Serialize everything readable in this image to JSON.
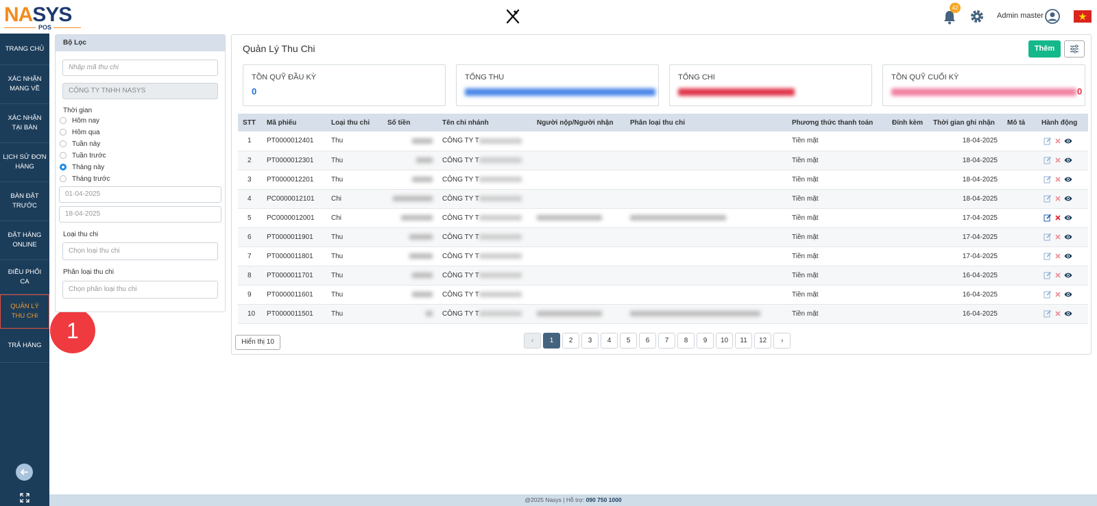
{
  "logo": {
    "na": "NA",
    "s": "SYS",
    "pos": "POS"
  },
  "header": {
    "notification_count": "42",
    "user_name": "Admin master"
  },
  "sidebar": {
    "items": [
      {
        "label": "TRANG CHỦ"
      },
      {
        "label": "XÁC NHẬN MANG VỀ"
      },
      {
        "label": "XÁC NHẬN TẠI BÀN"
      },
      {
        "label": "LỊCH SỬ ĐƠN HÀNG"
      },
      {
        "label": "BÀN ĐẶT TRƯỚC"
      },
      {
        "label": "ĐẶT HÀNG ONLINE"
      },
      {
        "label": "ĐIỀU PHỐI CA"
      },
      {
        "label": "QUẢN LÝ THU CHI"
      },
      {
        "label": "TRẢ HÀNG"
      }
    ]
  },
  "step_badge": "1",
  "filter": {
    "title": "Bộ Lọc",
    "code_placeholder": "Nhập mã thu chi",
    "company_value": "CÔNG TY TNHH NASYS",
    "time_label": "Thời gian",
    "time_options": [
      "Hôm nay",
      "Hôm qua",
      "Tuần này",
      "Tuần trước",
      "Tháng này",
      "Tháng trước"
    ],
    "selected_time": "Tháng này",
    "date_from": "01-04-2025",
    "date_to": "18-04-2025",
    "type_label": "Loại thu chi",
    "type_placeholder": "Chọn loại thu chi",
    "category_label": "Phân loại thu chi",
    "category_placeholder": "Chọn phân loại thu chi"
  },
  "main": {
    "title": "Quản Lý Thu Chi",
    "add_label": "Thêm",
    "cards": [
      {
        "label": "TỒN QUỸ ĐẦU KỲ",
        "value": "0",
        "color": "#1e6fd9"
      },
      {
        "label": "TỔNG THU",
        "value": "",
        "color": "#1e6fd9"
      },
      {
        "label": "TỔNG CHI",
        "value": "",
        "color": "#e0344a"
      },
      {
        "label": "TỒN QUỸ CUỐI KỲ",
        "value": "0",
        "color": "#e0344a"
      }
    ],
    "columns": [
      "STT",
      "Mã phiếu",
      "Loại thu chi",
      "Số tiền",
      "Tên chi nhánh",
      "Người nộp/Người nhận",
      "Phân loại thu chi",
      "Phương thức thanh toán",
      "Đính kèm",
      "Thời gian ghi nhận",
      "Mô tả",
      "Hành động"
    ],
    "rows": [
      {
        "stt": "1",
        "code": "PT0000012401",
        "type": "Thu",
        "amount": "",
        "branch": "CÔNG TY T",
        "person": "",
        "category": "",
        "method": "Tiền mặt",
        "date": "18-04-2025"
      },
      {
        "stt": "2",
        "code": "PT0000012301",
        "type": "Thu",
        "amount": "",
        "branch": "CÔNG TY T",
        "person": "",
        "category": "",
        "method": "Tiền mặt",
        "date": "18-04-2025"
      },
      {
        "stt": "3",
        "code": "PT0000012201",
        "type": "Thu",
        "amount": "",
        "branch": "CÔNG TY T",
        "person": "",
        "category": "",
        "method": "Tiền mặt",
        "date": "18-04-2025"
      },
      {
        "stt": "4",
        "code": "PC0000012101",
        "type": "Chi",
        "amount": "",
        "branch": "CÔNG TY T",
        "person": "",
        "category": "",
        "method": "Tiền mặt",
        "date": "18-04-2025"
      },
      {
        "stt": "5",
        "code": "PC0000012001",
        "type": "Chi",
        "amount": "",
        "branch": "CÔNG TY T",
        "person": "",
        "category": "",
        "method": "Tiền mặt",
        "date": "17-04-2025"
      },
      {
        "stt": "6",
        "code": "PT0000011901",
        "type": "Thu",
        "amount": "",
        "branch": "CÔNG TY T",
        "person": "",
        "category": "",
        "method": "Tiền mặt",
        "date": "17-04-2025"
      },
      {
        "stt": "7",
        "code": "PT0000011801",
        "type": "Thu",
        "amount": "",
        "branch": "CÔNG TY T",
        "person": "",
        "category": "",
        "method": "Tiền mặt",
        "date": "17-04-2025"
      },
      {
        "stt": "8",
        "code": "PT0000011701",
        "type": "Thu",
        "amount": "",
        "branch": "CÔNG TY T",
        "person": "",
        "category": "",
        "method": "Tiền mặt",
        "date": "16-04-2025"
      },
      {
        "stt": "9",
        "code": "PT0000011601",
        "type": "Thu",
        "amount": "",
        "branch": "CÔNG TY T",
        "person": "",
        "category": "",
        "method": "Tiền mặt",
        "date": "16-04-2025"
      },
      {
        "stt": "10",
        "code": "PT0000011501",
        "type": "Thu",
        "amount": "",
        "branch": "CÔNG TY T",
        "person": "",
        "category": "",
        "method": "Tiền mặt",
        "date": "16-04-2025"
      }
    ],
    "show_label": "Hiển thị 10",
    "pages": [
      "1",
      "2",
      "3",
      "4",
      "5",
      "6",
      "7",
      "8",
      "9",
      "10",
      "11",
      "12"
    ],
    "current_page": "1",
    "prev_label": "‹",
    "next_label": "›"
  },
  "footer": {
    "text": "@2025 Nasys | Hỗ trợ: ",
    "phone": "090 750 1000"
  },
  "colors": {
    "sidebar": "#1c3d5a",
    "accent_green": "#14b88a",
    "active_orange": "#f39c33"
  }
}
